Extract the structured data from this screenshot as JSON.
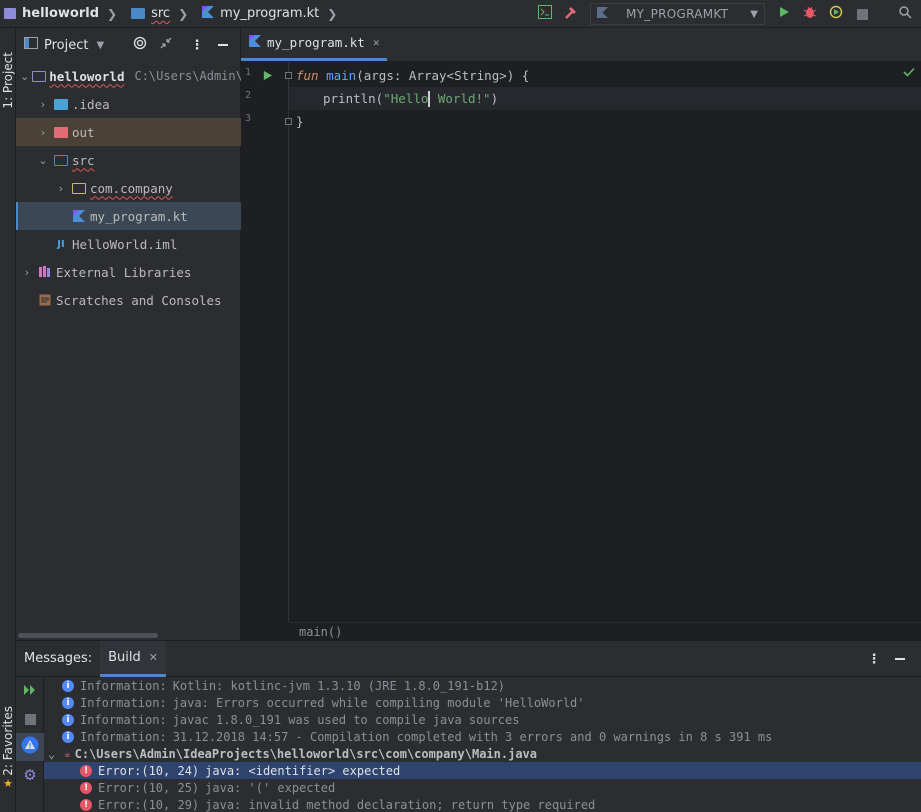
{
  "navbar": {
    "project": "helloworld",
    "folder": "src",
    "file": "my_program.kt",
    "run_config": "MY_PROGRAMKT",
    "icons": [
      "terminal-icon",
      "build-hammer-icon",
      "run-icon",
      "debug-icon",
      "coverage-icon",
      "stop-icon",
      "search-icon"
    ]
  },
  "left_strip": {
    "project_tab": "1: Project",
    "favorites_tab": "2: Favorites"
  },
  "project_panel": {
    "title": "Project",
    "tree": [
      {
        "label": "helloworld",
        "path": "C:\\Users\\Admin\\",
        "depth": 0,
        "expanded": true,
        "icon": "module-folder-icon"
      },
      {
        "label": ".idea",
        "depth": 1,
        "expanded": false,
        "icon": "folder-icon"
      },
      {
        "label": "out",
        "depth": 1,
        "expanded": false,
        "icon": "excluded-folder-icon"
      },
      {
        "label": "src",
        "depth": 1,
        "expanded": true,
        "icon": "source-folder-icon"
      },
      {
        "label": "com.company",
        "depth": 2,
        "expanded": false,
        "icon": "package-icon"
      },
      {
        "label": "my_program.kt",
        "depth": 2,
        "icon": "kotlin-file-icon"
      },
      {
        "label": "HelloWorld.iml",
        "depth": 1,
        "icon": "iml-file-icon"
      },
      {
        "label": "External Libraries",
        "depth": 0,
        "expanded": false,
        "icon": "libraries-icon"
      },
      {
        "label": "Scratches and Consoles",
        "depth": 0,
        "icon": "scratches-icon"
      }
    ]
  },
  "editor": {
    "tab_label": "my_program.kt",
    "line_numbers": [
      "1",
      "2",
      "3"
    ],
    "code": {
      "l1_fun": "fun",
      "l1_name": "main",
      "l1_open": "(",
      "l1_param": "args",
      "l1_colon": ": Array<String>) {",
      "l2_call": "println(",
      "l2_str_a": "\"Hello",
      "l2_str_b": " World!\"",
      "l2_close": ")",
      "l3": "}"
    },
    "breadcrumb": "main()"
  },
  "messages": {
    "label": "Messages:",
    "tab": "Build",
    "rows": [
      {
        "type": "info",
        "kind": "Information:",
        "text": "Kotlin: kotlinc-jvm 1.3.10 (JRE 1.8.0_191-b12)"
      },
      {
        "type": "info",
        "kind": "Information:",
        "text": "java: Errors occurred while compiling module 'HelloWorld'"
      },
      {
        "type": "info",
        "kind": "Information:",
        "text": "javac 1.8.0_191 was used to compile java sources"
      },
      {
        "type": "info",
        "kind": "Information:",
        "text": "31.12.2018 14:57 - Compilation completed with 3 errors and 0 warnings in 8 s 391 ms"
      },
      {
        "type": "file",
        "text": "C:\\Users\\Admin\\IdeaProjects\\helloworld\\src\\com\\company\\Main.java"
      },
      {
        "type": "error",
        "kind": "Error:(10, 24)",
        "text": "java: <identifier> expected"
      },
      {
        "type": "error",
        "kind": "Error:(10, 25)",
        "text": "java: '(' expected"
      },
      {
        "type": "error",
        "kind": "Error:(10, 29)",
        "text": "java: invalid method declaration; return type required"
      }
    ]
  }
}
